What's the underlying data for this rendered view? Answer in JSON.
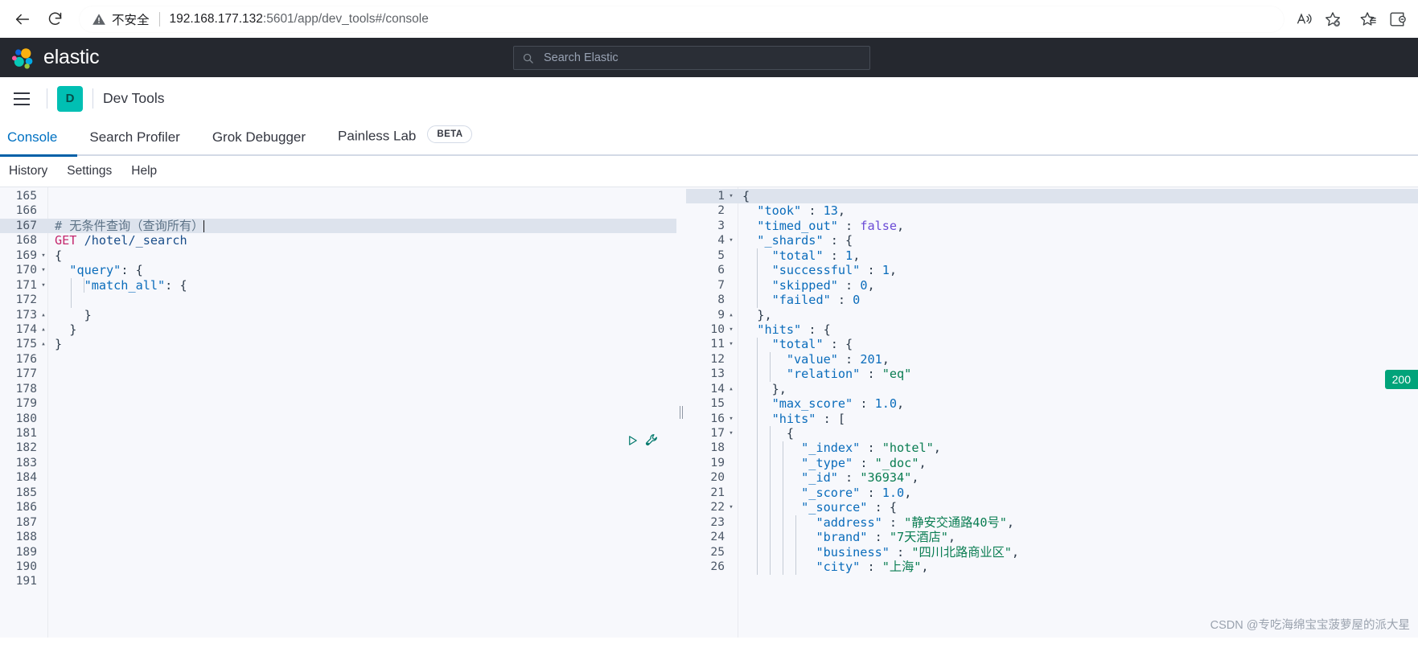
{
  "browser": {
    "back_icon": "arrow-left-icon",
    "reload_icon": "reload-icon",
    "security_icon": "warning-triangle-icon",
    "security_label": "不安全",
    "url_host": "192.168.177.132",
    "url_path": ":5601/app/dev_tools#/console",
    "toolbar_icons": [
      "read-aloud-icon",
      "add-favorite-icon",
      "favorites-icon",
      "collections-icon"
    ]
  },
  "elastic_header": {
    "brand": "elastic",
    "logo_icon": "elastic-logo-icon",
    "search": {
      "icon": "search-icon",
      "placeholder": "Search Elastic",
      "value": ""
    }
  },
  "app_nav": {
    "menu_icon": "hamburger-menu-icon",
    "app_initial": "D",
    "title": "Dev Tools"
  },
  "tabs": [
    {
      "label": "Console",
      "active": true
    },
    {
      "label": "Search Profiler",
      "active": false
    },
    {
      "label": "Grok Debugger",
      "active": false
    },
    {
      "label": "Painless Lab",
      "active": false,
      "badge": "BETA"
    }
  ],
  "submenu": [
    {
      "label": "History"
    },
    {
      "label": "Settings"
    },
    {
      "label": "Help"
    }
  ],
  "request_actions": {
    "play_icon": "play-triangle-icon",
    "wrench_icon": "wrench-icon"
  },
  "status": {
    "code": "200"
  },
  "splitter": {
    "icon": "drag-handle-icon"
  },
  "watermark": "CSDN @专吃海绵宝宝菠萝屋的派大星",
  "editor": {
    "highlighted_line": 167,
    "cursor_line": 167,
    "lines": [
      {
        "n": 165,
        "text": ""
      },
      {
        "n": 166,
        "text": ""
      },
      {
        "n": 167,
        "text": "# 无条件查询（查询所有）"
      },
      {
        "n": 168,
        "text": "GET /hotel/_search"
      },
      {
        "n": 169,
        "text": "{",
        "fold": "open"
      },
      {
        "n": 170,
        "text": "  \"query\": {",
        "fold": "open"
      },
      {
        "n": 171,
        "text": "    \"match_all\": {",
        "fold": "open"
      },
      {
        "n": 172,
        "text": "      "
      },
      {
        "n": 173,
        "text": "    }",
        "fold": "close"
      },
      {
        "n": 174,
        "text": "  }",
        "fold": "close"
      },
      {
        "n": 175,
        "text": "}",
        "fold": "close"
      },
      {
        "n": 176,
        "text": ""
      },
      {
        "n": 177,
        "text": ""
      },
      {
        "n": 178,
        "text": ""
      },
      {
        "n": 179,
        "text": ""
      },
      {
        "n": 180,
        "text": ""
      },
      {
        "n": 181,
        "text": ""
      },
      {
        "n": 182,
        "text": ""
      },
      {
        "n": 183,
        "text": ""
      },
      {
        "n": 184,
        "text": ""
      },
      {
        "n": 185,
        "text": ""
      },
      {
        "n": 186,
        "text": ""
      },
      {
        "n": 187,
        "text": ""
      },
      {
        "n": 188,
        "text": ""
      },
      {
        "n": 189,
        "text": ""
      },
      {
        "n": 190,
        "text": ""
      },
      {
        "n": 191,
        "text": ""
      }
    ]
  },
  "response": {
    "highlighted_line": 1,
    "lines": [
      {
        "n": 1,
        "text": "{",
        "fold": "open"
      },
      {
        "n": 2,
        "text": "  \"took\" : 13,"
      },
      {
        "n": 3,
        "text": "  \"timed_out\" : false,"
      },
      {
        "n": 4,
        "text": "  \"_shards\" : {",
        "fold": "open"
      },
      {
        "n": 5,
        "text": "    \"total\" : 1,"
      },
      {
        "n": 6,
        "text": "    \"successful\" : 1,"
      },
      {
        "n": 7,
        "text": "    \"skipped\" : 0,"
      },
      {
        "n": 8,
        "text": "    \"failed\" : 0"
      },
      {
        "n": 9,
        "text": "  },",
        "fold": "close"
      },
      {
        "n": 10,
        "text": "  \"hits\" : {",
        "fold": "open"
      },
      {
        "n": 11,
        "text": "    \"total\" : {",
        "fold": "open"
      },
      {
        "n": 12,
        "text": "      \"value\" : 201,"
      },
      {
        "n": 13,
        "text": "      \"relation\" : \"eq\""
      },
      {
        "n": 14,
        "text": "    },",
        "fold": "close"
      },
      {
        "n": 15,
        "text": "    \"max_score\" : 1.0,"
      },
      {
        "n": 16,
        "text": "    \"hits\" : [",
        "fold": "open"
      },
      {
        "n": 17,
        "text": "      {",
        "fold": "open"
      },
      {
        "n": 18,
        "text": "        \"_index\" : \"hotel\","
      },
      {
        "n": 19,
        "text": "        \"_type\" : \"_doc\","
      },
      {
        "n": 20,
        "text": "        \"_id\" : \"36934\","
      },
      {
        "n": 21,
        "text": "        \"_score\" : 1.0,"
      },
      {
        "n": 22,
        "text": "        \"_source\" : {",
        "fold": "open"
      },
      {
        "n": 23,
        "text": "          \"address\" : \"静安交通路40号\","
      },
      {
        "n": 24,
        "text": "          \"brand\" : \"7天酒店\","
      },
      {
        "n": 25,
        "text": "          \"business\" : \"四川北路商业区\","
      },
      {
        "n": 26,
        "text": "          \"city\" : \"上海\","
      }
    ]
  }
}
